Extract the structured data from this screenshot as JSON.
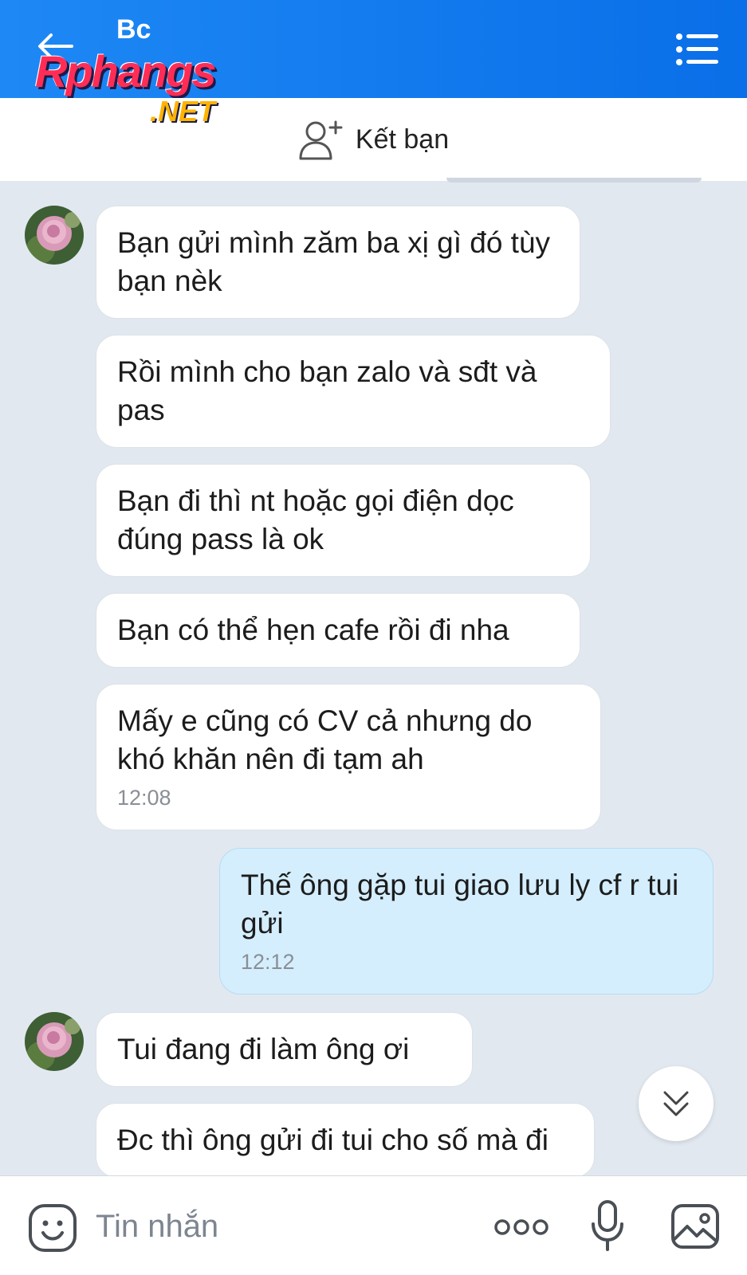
{
  "header": {
    "title": "Bc",
    "watermark_main": "Rphangs",
    "watermark_suffix": ".NET"
  },
  "friend_bar": {
    "label": "Kết bạn"
  },
  "messages": [
    {
      "sender": "other",
      "text": " Bạn gửi mình zăm ba xị gì đó tùy bạn nèk",
      "time": ""
    },
    {
      "sender": "other",
      "text": "Rồi mình cho bạn zalo và sđt và pas",
      "time": ""
    },
    {
      "sender": "other",
      "text": "Bạn đi thì nt hoặc gọi điện dọc đúng pass là ok",
      "time": ""
    },
    {
      "sender": "other",
      "text": "Bạn có thể hẹn cafe rồi đi nha",
      "time": ""
    },
    {
      "sender": "other",
      "text": "Mấy e cũng có CV cả nhưng do khó khăn nên đi tạm ah",
      "time": "12:08"
    },
    {
      "sender": "me",
      "text": "Thế ông gặp tui giao lưu ly cf r tui gửi",
      "time": "12:12"
    },
    {
      "sender": "other",
      "text": "Tui đang đi làm ông ơi",
      "time": ""
    },
    {
      "sender": "other",
      "text": "Đc thì ông gửi đi tui cho số mà đi",
      "time": ""
    }
  ],
  "composer": {
    "placeholder": "Tin nhắn"
  },
  "icons": {
    "back": "back-arrow-icon",
    "menu": "menu-list-icon",
    "add_friend": "add-user-icon",
    "scroll_down": "double-chevron-down-icon",
    "emoji": "emoji-icon",
    "more": "more-dots-icon",
    "mic": "microphone-icon",
    "image": "image-icon"
  },
  "colors": {
    "header": "#0a6fe8",
    "background": "#e2e8f0",
    "bubble_other": "#ffffff",
    "bubble_mine": "#d4eefd",
    "timestamp": "#8a8f95"
  }
}
